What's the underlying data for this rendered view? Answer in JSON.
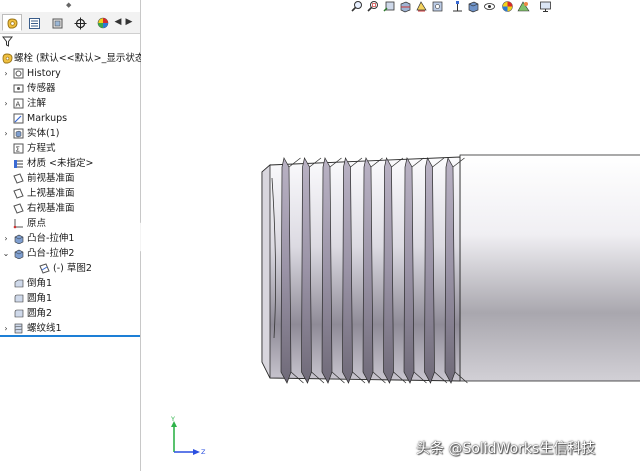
{
  "feature_tree": {
    "part": {
      "label": "螺栓 (默认<<默认>_显示状态"
    },
    "items": [
      {
        "label": "History",
        "icon": "history-icon",
        "expandable": true
      },
      {
        "label": "传感器",
        "icon": "sensor-icon",
        "expandable": false
      },
      {
        "label": "注解",
        "icon": "annotation-icon",
        "expandable": true
      },
      {
        "label": "Markups",
        "icon": "markup-icon",
        "expandable": false
      },
      {
        "label": "实体(1)",
        "icon": "solid-bodies-icon",
        "expandable": true
      },
      {
        "label": "方程式",
        "icon": "equation-icon",
        "expandable": false
      },
      {
        "label": "材质 <未指定>",
        "icon": "material-icon",
        "expandable": false
      },
      {
        "label": "前视基准面",
        "icon": "plane-icon",
        "expandable": false
      },
      {
        "label": "上视基准面",
        "icon": "plane-icon",
        "expandable": false
      },
      {
        "label": "右视基准面",
        "icon": "plane-icon",
        "expandable": false
      },
      {
        "label": "原点",
        "icon": "origin-icon",
        "expandable": false
      },
      {
        "label": "凸台-拉伸1",
        "icon": "extrude-icon",
        "expandable": true
      },
      {
        "label": "凸台-拉伸2",
        "icon": "extrude-icon",
        "expandable": true,
        "expanded": true
      },
      {
        "label": "(-) 草图2",
        "icon": "sketch-icon",
        "expandable": false,
        "child": true
      },
      {
        "label": "倒角1",
        "icon": "chamfer-icon",
        "expandable": false
      },
      {
        "label": "圆角1",
        "icon": "fillet-icon",
        "expandable": false
      },
      {
        "label": "圆角2",
        "icon": "fillet-icon",
        "expandable": false
      },
      {
        "label": "螺纹线1",
        "icon": "thread-icon",
        "expandable": true
      }
    ]
  },
  "triad": {
    "y": "Y",
    "z": "Z"
  },
  "watermark": "头条 @SolidWorks生信科技",
  "colors": {
    "selection_bar": "#1d7fd6",
    "part_body": "#d9d7de",
    "thread_shade": "#8e8a96"
  }
}
